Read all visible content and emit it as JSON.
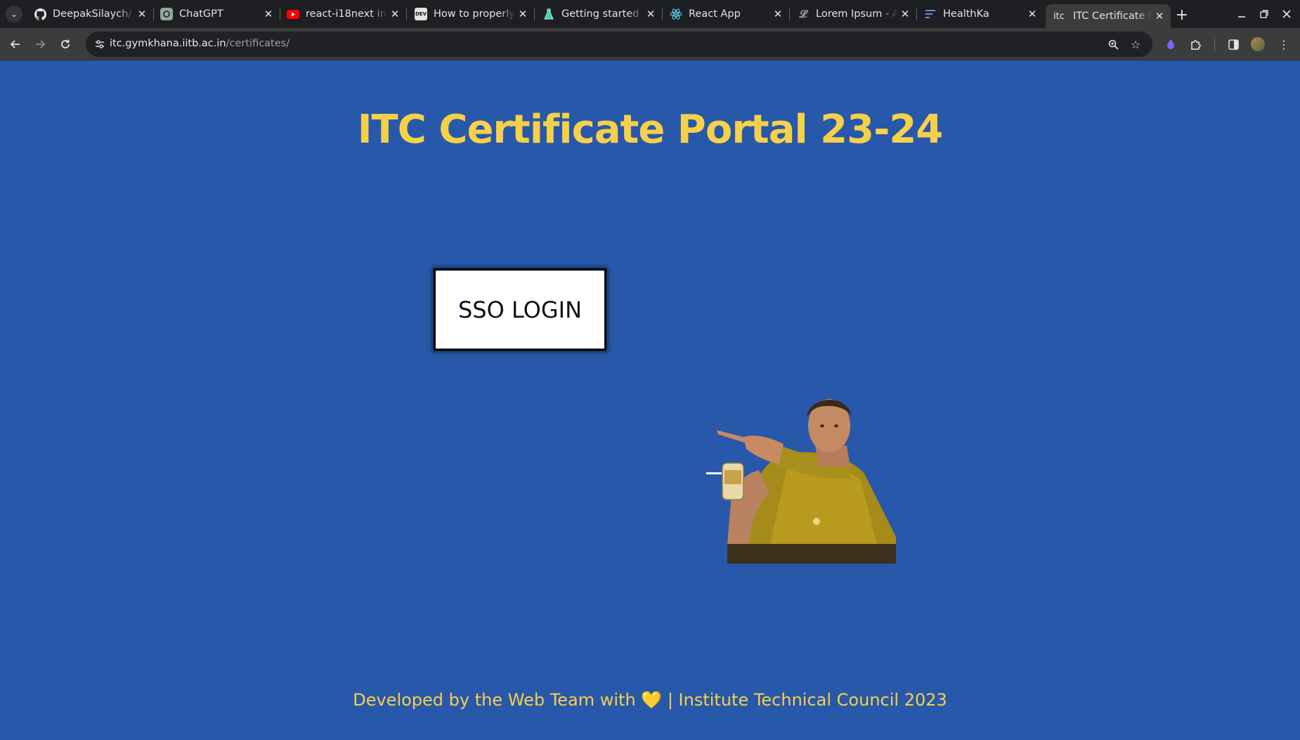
{
  "browser": {
    "tabs": [
      {
        "title": "DeepakSilaych/",
        "favicon": "github-icon",
        "active": false
      },
      {
        "title": "ChatGPT",
        "favicon": "chatgpt-icon",
        "active": false
      },
      {
        "title": "react-i18next in",
        "favicon": "youtube-icon",
        "active": false
      },
      {
        "title": "How to properly",
        "favicon": "dev-icon",
        "favicon_text": "DEV",
        "active": false
      },
      {
        "title": "Getting started",
        "favicon": "flask-icon",
        "active": false
      },
      {
        "title": "React App",
        "favicon": "react-icon",
        "active": false
      },
      {
        "title": "Lorem Ipsum - A",
        "favicon": "lorem-icon",
        "active": false
      },
      {
        "title": "HealthKa",
        "favicon": "healthka-icon",
        "active": false
      },
      {
        "title": "ITC Certificate P",
        "favicon": "itc-icon",
        "favicon_text": "itc",
        "active": true
      }
    ],
    "address": {
      "host": "itc.gymkhana.iitb.ac.in",
      "path": "/certificates/"
    }
  },
  "page": {
    "heading": "ITC Certificate Portal 23-24",
    "sso_button": "SSO LOGIN",
    "meme_image": "man-pointing-with-drink",
    "footer": "Developed by the Web Team with 💛 | Institute Technical Council 2023"
  },
  "colors": {
    "page_background": "#2758aa",
    "accent_yellow": "#f7d04a",
    "button_background": "#ffffff"
  }
}
